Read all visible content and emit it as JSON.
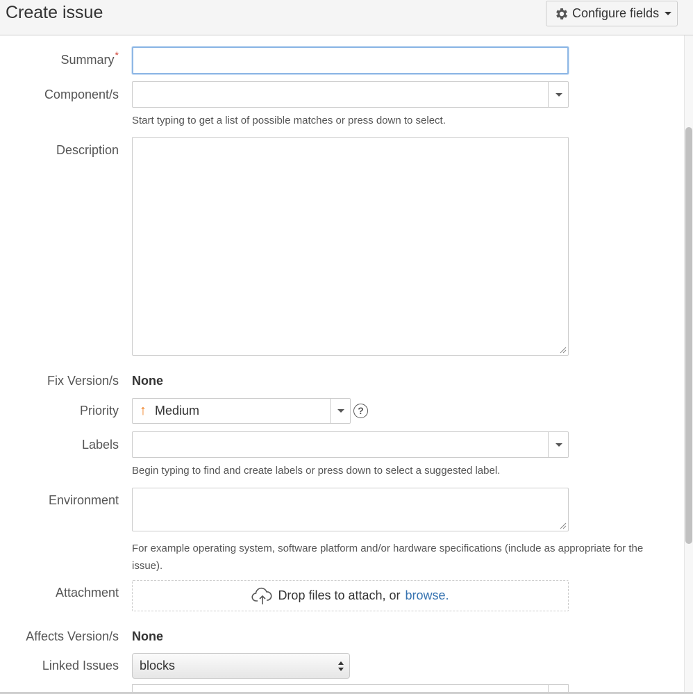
{
  "header": {
    "title": "Create issue",
    "configure_label": "Configure fields",
    "configure_icon": "gear-icon"
  },
  "fields": {
    "summary": {
      "label": "Summary",
      "required_mark": "*",
      "value": ""
    },
    "components": {
      "label": "Component/s",
      "value": "",
      "help": "Start typing to get a list of possible matches or press down to select."
    },
    "description": {
      "label": "Description",
      "value": ""
    },
    "fix_versions": {
      "label": "Fix Version/s",
      "value": "None"
    },
    "priority": {
      "label": "Priority",
      "value": "Medium",
      "icon": "arrow-up-icon",
      "icon_color": "#f07c1b",
      "help_icon": "question-circle-icon"
    },
    "labels": {
      "label": "Labels",
      "value": "",
      "help": "Begin typing to find and create labels or press down to select a suggested label."
    },
    "environment": {
      "label": "Environment",
      "value": "",
      "help_line1": "For example operating system, software platform and/or hardware specifications (include as appropriate for the",
      "help_line2": "issue)."
    },
    "attachment": {
      "label": "Attachment",
      "drop_text": "Drop files to attach, or",
      "browse_label": "browse.",
      "icon": "cloud-upload-icon"
    },
    "affects_versions": {
      "label": "Affects Version/s",
      "value": "None"
    },
    "linked_issues": {
      "label": "Linked Issues",
      "selected": "blocks"
    }
  },
  "colors": {
    "required": "#d04437",
    "link": "#3572b0",
    "focus_border": "#8fb8e5"
  }
}
